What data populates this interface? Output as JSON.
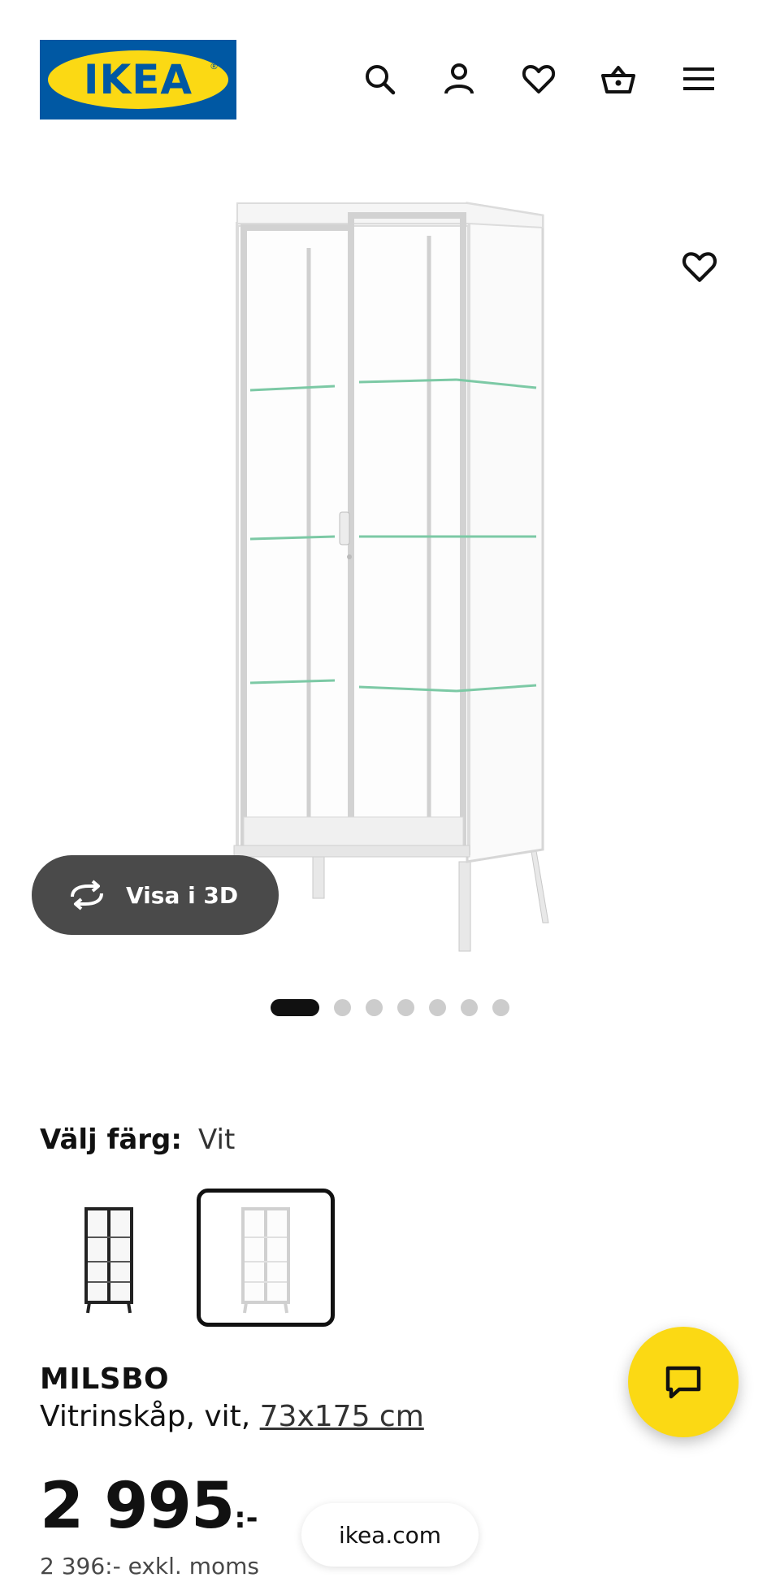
{
  "header": {
    "logo_text": "IKEA",
    "logo_reg": "®",
    "icons": [
      "search-icon",
      "account-icon",
      "heart-icon",
      "basket-icon",
      "menu-icon"
    ]
  },
  "gallery": {
    "visa3d_label": "Visa i 3D",
    "dots_count": 7,
    "active_dot": 0
  },
  "color": {
    "label": "Välj färg:",
    "value": "Vit",
    "swatches": [
      "black",
      "white"
    ],
    "selected": "white"
  },
  "product": {
    "name": "MILSBO",
    "desc_prefix": "Vitrinskåp, vit, ",
    "size_link": "73x175 cm",
    "price": "2 995",
    "price_suffix": ":-",
    "excl_vat": "2 396:- exkl. moms"
  },
  "browser": {
    "url": "ikea.com"
  },
  "colors": {
    "ikea_blue": "#0058a3",
    "ikea_yellow": "#fbd914",
    "dark_button": "#4a4a4a"
  }
}
